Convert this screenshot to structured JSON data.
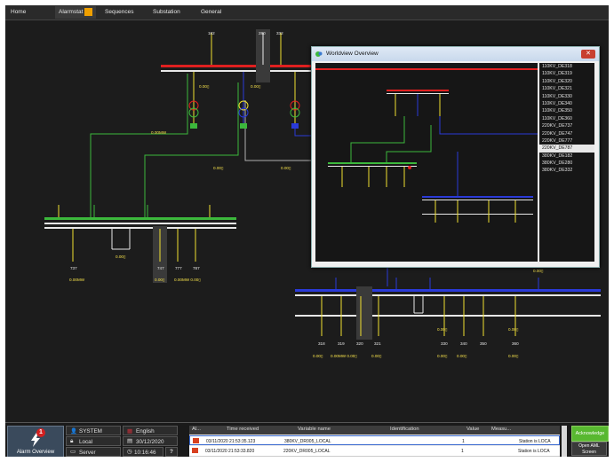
{
  "tabs": [
    {
      "label": "Home",
      "active": false
    },
    {
      "label": "Alarmstat",
      "active": true
    },
    {
      "label": "Sequences",
      "active": false
    },
    {
      "label": "Substation",
      "active": false
    },
    {
      "label": "General",
      "active": false
    }
  ],
  "diagram": {
    "top_feeders": [
      "182",
      "280",
      "332"
    ],
    "left_feeders": [
      "737",
      "747",
      "777",
      "787"
    ],
    "right_feeders": [
      "318",
      "319",
      "320",
      "321",
      "330",
      "340",
      "350",
      "360"
    ],
    "values": {
      "v1": "0.00▯",
      "v2": "0.00▯",
      "v3": "0.00MW",
      "v4": "0.00▯",
      "v5": "0.00▯",
      "v6": "0.00▯",
      "v7": "0.00MW",
      "v8": "0.00▯",
      "v9": "0.00MW 0.00▯",
      "v10": "0.00▯",
      "v11": "0.00▯",
      "v12": "0.00▯",
      "v13": "0.00▯",
      "v14": "0.00MW 0.00▯",
      "v15": "0.00▯",
      "v16": "0.00▯",
      "v17": "0.00▯",
      "v18": "0.00▯"
    },
    "colors": {
      "red": "#e02020",
      "blue": "#2a3ad8",
      "green": "#3cb83c",
      "white": "#e8e8e8",
      "yellow": "#f0e030",
      "grey": "#9a9a9a"
    }
  },
  "worldview": {
    "title": "Worldview Overview",
    "items": [
      "110KV_DE318",
      "110KV_DE319",
      "110KV_DE320",
      "110KV_DE321",
      "110KV_DE330",
      "110KV_DE340",
      "110KV_DE350",
      "110KV_DE360",
      "220KV_DE737",
      "220KV_DE747",
      "220KV_DE777",
      "220KV_DE787",
      "380KV_DE182",
      "380KV_DE280",
      "380KV_DE332"
    ],
    "selected_index": 11
  },
  "status": {
    "alarm_overview_label": "Alarm Overview",
    "alarm_count": "1",
    "user": "SYSTEM",
    "language": "English",
    "mode": "Local",
    "date": "30/12/2020",
    "server": "Server",
    "time": "10:16:46",
    "help": "?"
  },
  "alarm_table": {
    "headers": [
      "Al...",
      "Time received",
      "Variable name",
      "Identification",
      "Value",
      "Measu..."
    ],
    "rows": [
      {
        "time": "03/11/2020 21:53:35.123",
        "variable": "380KV_DR005_LOCAL",
        "identification": "",
        "value": "1",
        "measure": "Station is LOCA"
      },
      {
        "time": "03/11/2020 21:53:33.820",
        "variable": "220KV_DR005_LOCAL",
        "identification": "",
        "value": "1",
        "measure": "Station is LOCA"
      }
    ]
  },
  "buttons": {
    "acknowledge": "Acknowledge",
    "open_aml_line1": "Open AML",
    "open_aml_line2": "Screen"
  }
}
